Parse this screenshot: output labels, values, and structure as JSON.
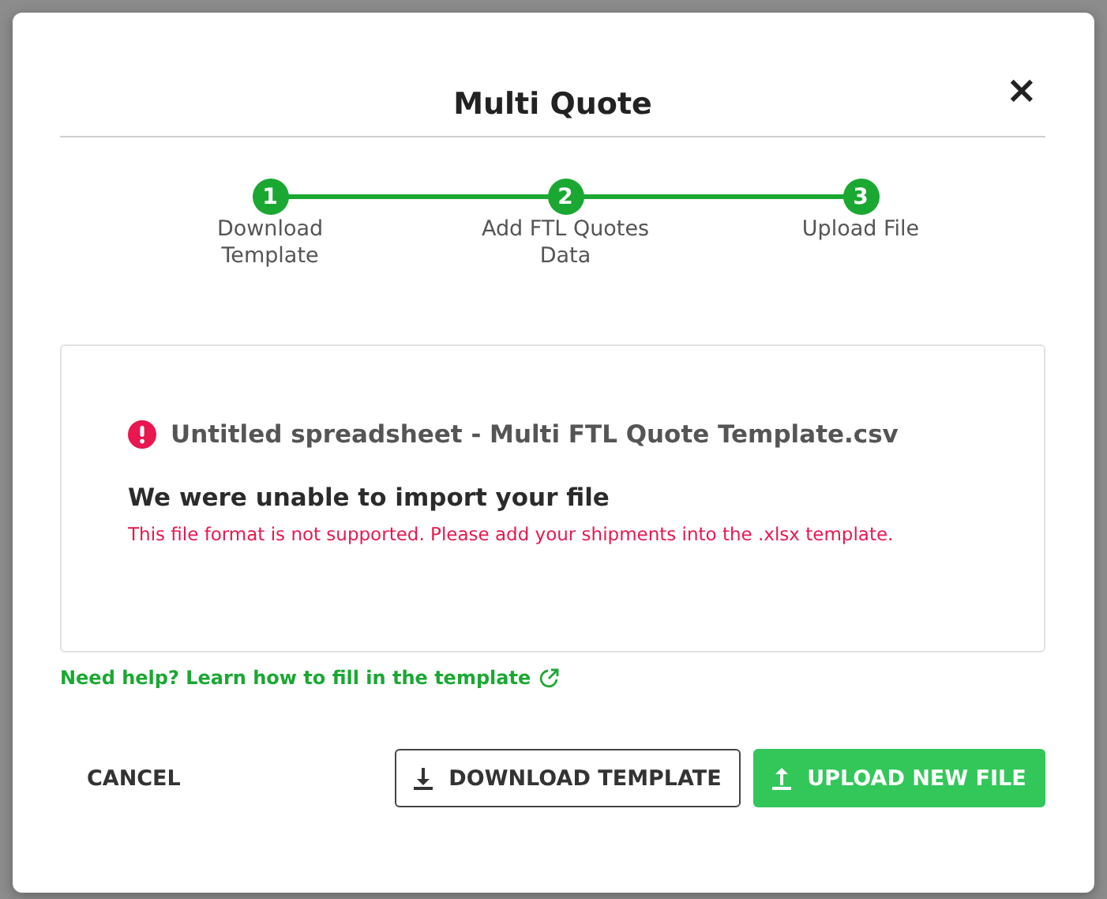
{
  "dialog": {
    "title": "Multi Quote",
    "close": "×"
  },
  "steps": [
    {
      "number": "1",
      "label": "Download Template",
      "completed": true
    },
    {
      "number": "2",
      "label": "Add FTL Quotes Data",
      "completed": true
    },
    {
      "number": "3",
      "label": "Upload File",
      "completed": true
    }
  ],
  "error_card": {
    "file_name": "Untitled spreadsheet - Multi FTL Quote Template.csv",
    "heading": "We were unable to import your file",
    "message": "This file format is not supported. Please add your shipments into the .xlsx template."
  },
  "help_link": "Need help? Learn how to fill in the template",
  "buttons": [
    {
      "kind": "text",
      "label": "CANCEL"
    },
    {
      "kind": "outline",
      "label": "DOWNLOAD TEMPLATE"
    },
    {
      "kind": "primary",
      "label": "UPLOAD NEW FILE"
    }
  ]
}
